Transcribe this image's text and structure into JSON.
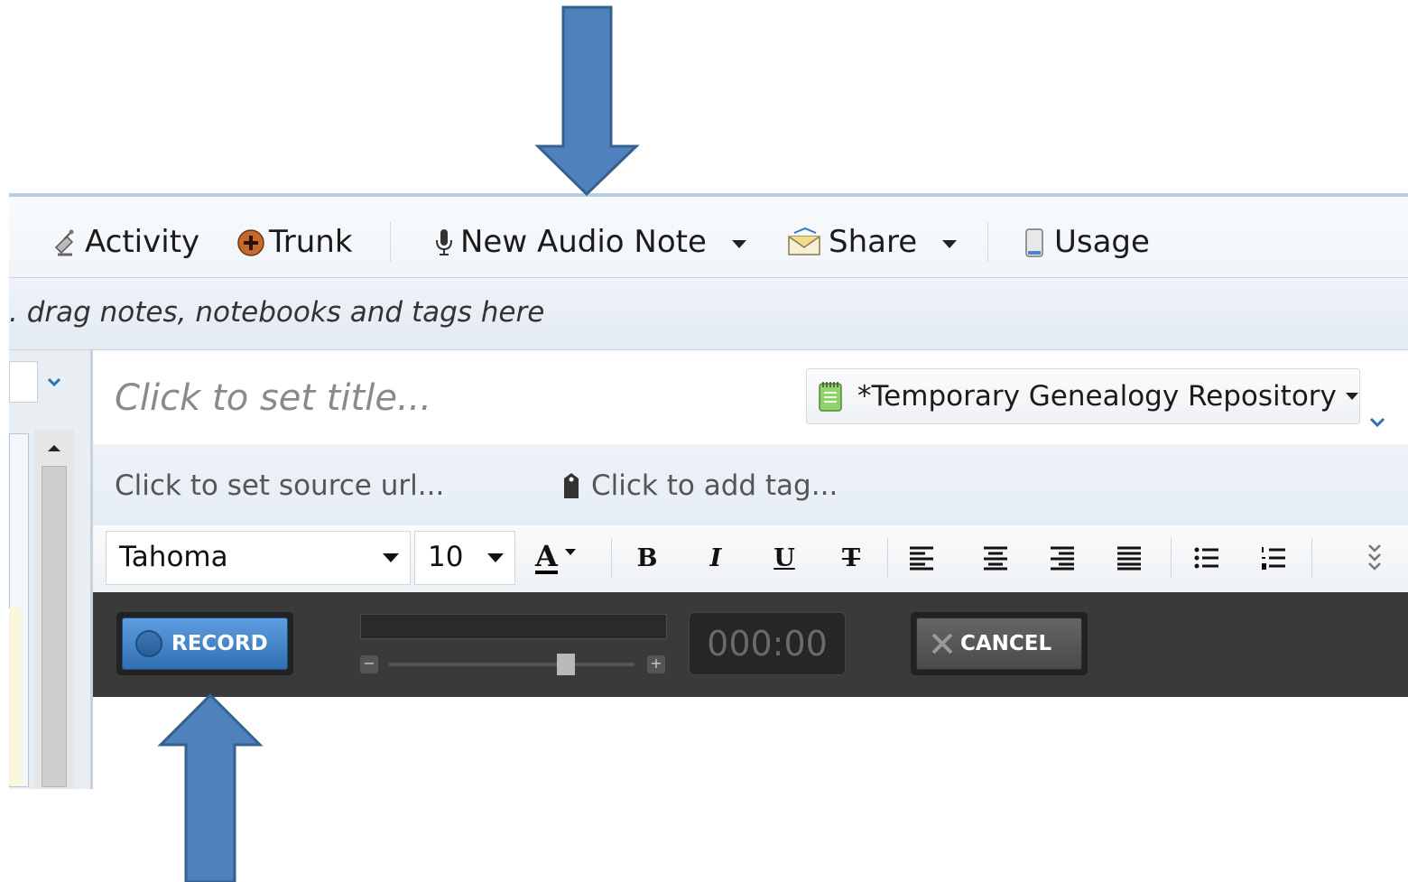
{
  "toolbar": {
    "activity_label": "Activity",
    "trunk_label": "Trunk",
    "new_audio_note_label": "New Audio Note",
    "share_label": "Share",
    "usage_label": "Usage"
  },
  "shortcuts_bar": {
    "hint": ". drag notes, notebooks and tags here"
  },
  "note": {
    "title_placeholder": "Click to set title...",
    "notebook_name": "*Temporary Genealogy Repository",
    "source_url_placeholder": "Click to set source url...",
    "tag_placeholder": "Click to add tag..."
  },
  "format_bar": {
    "font_family": "Tahoma",
    "font_size": "10",
    "font_color_label": "A",
    "bold_label": "B",
    "italic_label": "I",
    "underline_label": "U",
    "strike_label": "T"
  },
  "recorder": {
    "record_label": "RECORD",
    "timer": "000:00",
    "cancel_label": "CANCEL",
    "volume_level": 0.72
  },
  "colors": {
    "arrow_fill": "#4f81bd",
    "arrow_stroke": "#35608f",
    "record_blue": "#3f7fc2",
    "recorder_bg": "#3a3a3a"
  }
}
